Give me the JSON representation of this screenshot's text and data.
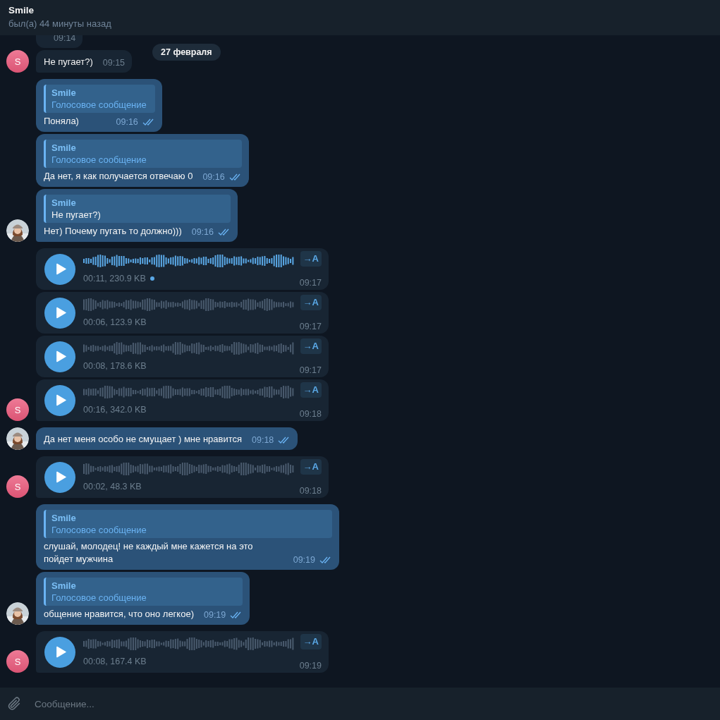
{
  "header": {
    "title": "Smile",
    "status": "был(а) 44 минуты назад"
  },
  "date_pill": "27 февраля",
  "messages": [
    {
      "outgoing": false,
      "kind": "text",
      "time": "09:14"
    },
    {
      "outgoing": false,
      "kind": "text",
      "text": "Не пугает?)",
      "time": "09:15",
      "avatar": {
        "kind": "letter",
        "letter": "S"
      }
    },
    {
      "outgoing": true,
      "kind": "text",
      "reply": {
        "name": "Smile",
        "text": "Голосовое сообщение",
        "kind": "media"
      },
      "text": "Поняла)",
      "time": "09:16",
      "read": true
    },
    {
      "outgoing": true,
      "kind": "text",
      "reply": {
        "name": "Smile",
        "text": "Голосовое сообщение",
        "kind": "media"
      },
      "text": "Да нет, я как получается отвечаю 0",
      "time": "09:16",
      "read": true
    },
    {
      "outgoing": true,
      "kind": "text",
      "reply": {
        "name": "Smile",
        "text": "Не пугает?)",
        "kind": "text"
      },
      "text": "Нет) Почему пугать то должно)))",
      "time": "09:16",
      "read": true,
      "avatar": {
        "kind": "photo"
      }
    },
    {
      "outgoing": false,
      "kind": "voice",
      "info": "00:11, 230.9 KB",
      "listened": false,
      "transcribe": "→A",
      "time": "09:17"
    },
    {
      "outgoing": false,
      "kind": "voice",
      "info": "00:06, 123.9 KB",
      "listened": true,
      "transcribe": "→A",
      "time": "09:17"
    },
    {
      "outgoing": false,
      "kind": "voice",
      "info": "00:08, 178.6 KB",
      "listened": true,
      "transcribe": "→A",
      "time": "09:17"
    },
    {
      "outgoing": false,
      "kind": "voice",
      "info": "00:16, 342.0 KB",
      "listened": true,
      "transcribe": "→A",
      "time": "09:18",
      "avatar": {
        "kind": "letter",
        "letter": "S"
      }
    },
    {
      "outgoing": true,
      "kind": "text",
      "text": "Да нет меня особо не смущает ) мне нравится",
      "time": "09:18",
      "read": true,
      "avatar": {
        "kind": "photo"
      }
    },
    {
      "outgoing": false,
      "kind": "voice",
      "info": "00:02, 48.3 KB",
      "listened": true,
      "transcribe": "→A",
      "time": "09:18",
      "avatar": {
        "kind": "letter",
        "letter": "S"
      }
    },
    {
      "outgoing": true,
      "kind": "text",
      "reply": {
        "name": "Smile",
        "text": "Голосовое сообщение",
        "kind": "media"
      },
      "text": "слушай, молодец! не каждый мне кажется на это пойдет мужчина",
      "time": "09:19",
      "read": true
    },
    {
      "outgoing": true,
      "kind": "text",
      "reply": {
        "name": "Smile",
        "text": "Голосовое сообщение",
        "kind": "media"
      },
      "text": "общение нравится, что оно легкое)",
      "time": "09:19",
      "read": true,
      "avatar": {
        "kind": "photo"
      }
    },
    {
      "outgoing": false,
      "kind": "voice",
      "info": "00:08, 167.4 KB",
      "listened": true,
      "transcribe": "→A",
      "time": "09:19",
      "avatar": {
        "kind": "letter",
        "letter": "S"
      }
    }
  ],
  "composer": {
    "placeholder": "Сообщение..."
  }
}
